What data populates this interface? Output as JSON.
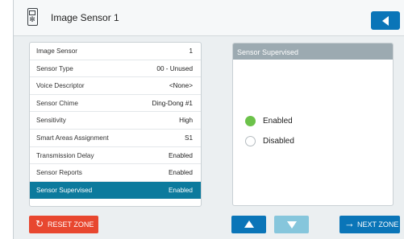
{
  "header": {
    "title": "Image Sensor 1",
    "device_icon": "sensor-device-icon",
    "back_icon": "back-triangle-icon"
  },
  "list": {
    "rows": [
      {
        "label": "Image Sensor",
        "value": "1"
      },
      {
        "label": "Sensor Type",
        "value": "00 - Unused"
      },
      {
        "label": "Voice Descriptor",
        "value": "<None>"
      },
      {
        "label": "Sensor Chime",
        "value": "Ding-Dong #1"
      },
      {
        "label": "Sensitivity",
        "value": "High"
      },
      {
        "label": "Smart Areas Assignment",
        "value": "S1"
      },
      {
        "label": "Transmission Delay",
        "value": "Enabled"
      },
      {
        "label": "Sensor Reports",
        "value": "Enabled"
      },
      {
        "label": "Sensor Supervised",
        "value": "Enabled",
        "selected": true
      }
    ]
  },
  "panel": {
    "title": "Sensor Supervised",
    "options": [
      {
        "label": "Enabled",
        "selected": true
      },
      {
        "label": "Disabled",
        "selected": false
      }
    ]
  },
  "footer": {
    "reset_label": "RESET ZONE",
    "next_label": "NEXT ZONE",
    "colors": {
      "primary": "#0a75b8",
      "danger": "#e8472f",
      "selected_row": "#0c7a9d",
      "active_option": "#6cc24a"
    }
  }
}
